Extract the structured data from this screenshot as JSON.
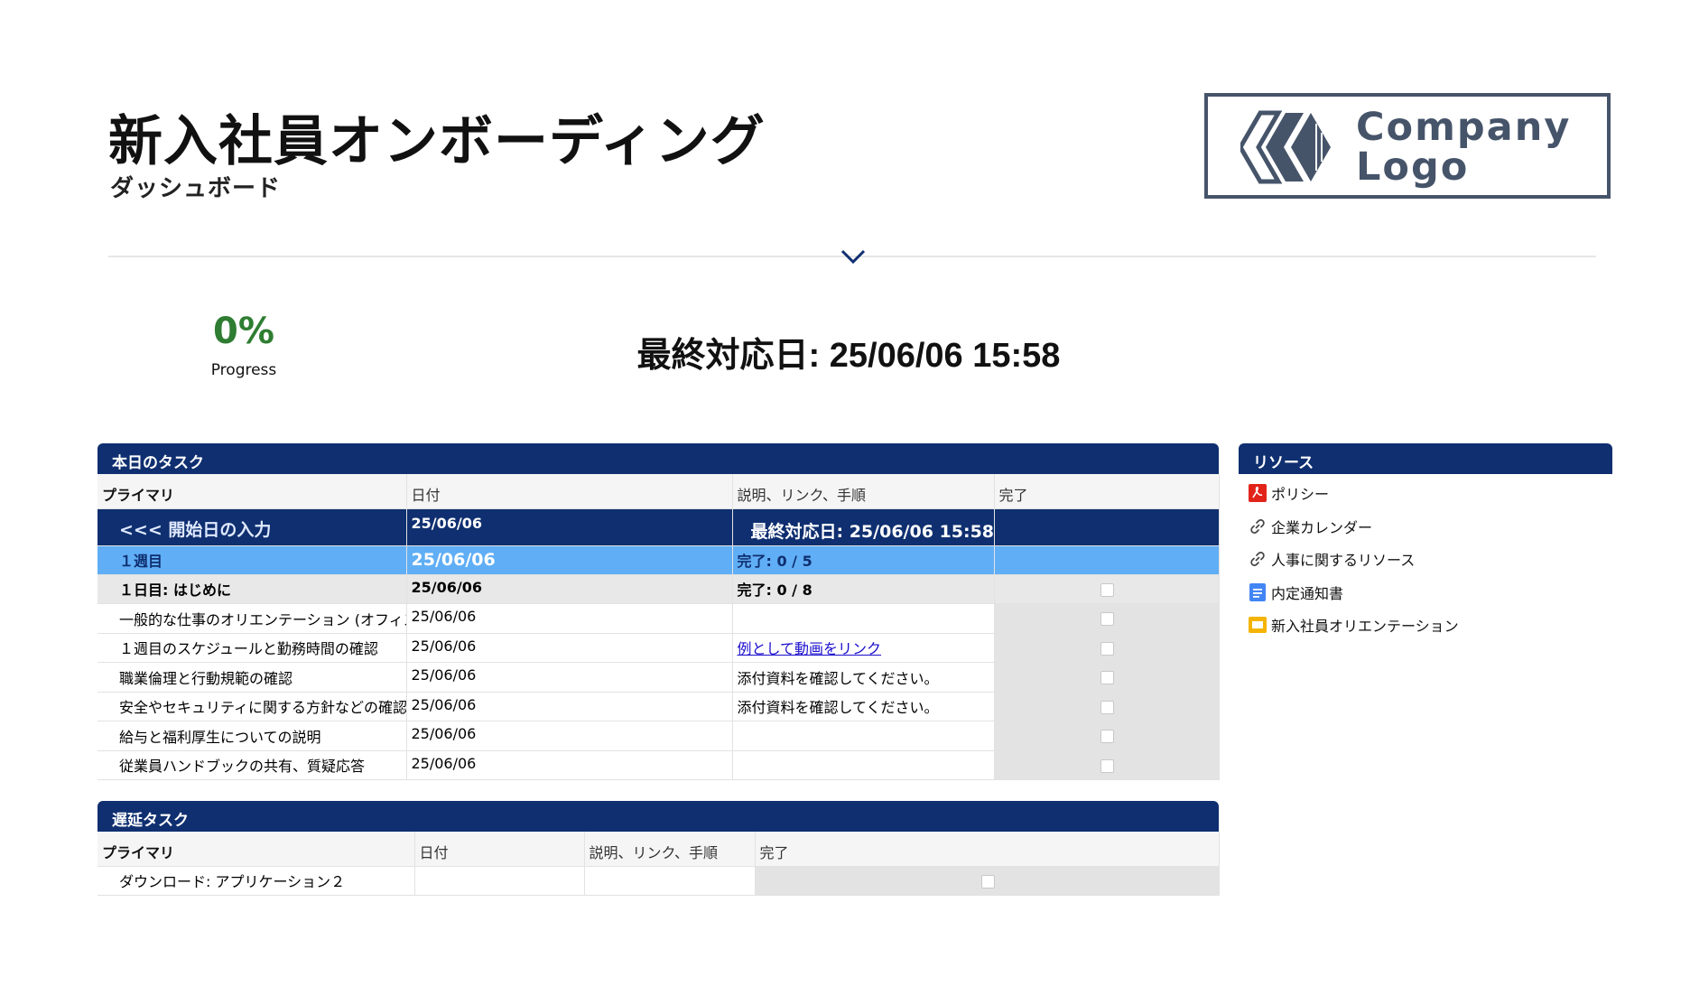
{
  "header": {
    "title": "新入社員オンボーディング",
    "subtitle": "ダッシュボード",
    "logo_text_line1": "Company",
    "logo_text_line2": "Logo"
  },
  "summary": {
    "progress_value": "0%",
    "progress_label": "Progress",
    "last_update": "最終対応日: 25/06/06 15:58"
  },
  "today_tasks": {
    "section_title": "本日のタスク",
    "columns": [
      "プライマリ",
      "日付",
      "説明、リンク、手順",
      "完了"
    ],
    "start_row": {
      "primary": "<<< 開始日の入力",
      "date": "25/06/06",
      "desc": "最終対応日: 25/06/06 15:58"
    },
    "week_row": {
      "primary": "１週目",
      "date": "25/06/06",
      "desc": "完了: 0 / 5"
    },
    "day_row": {
      "primary": "１日目: はじめに",
      "date": "25/06/06",
      "desc": "完了: 0 / 8"
    },
    "rows": [
      {
        "primary": "一般的な仕事のオリエンテーション (オフィスツアー",
        "date": "25/06/06",
        "desc": "",
        "done": false
      },
      {
        "primary": "１週目のスケジュールと勤務時間の確認",
        "date": "25/06/06",
        "desc": "例として動画をリンク",
        "done": false
      },
      {
        "primary": "職業倫理と行動規範の確認",
        "date": "25/06/06",
        "desc": "添付資料を確認してください。",
        "done": false
      },
      {
        "primary": "安全やセキュリティに関する方針などの確認",
        "date": "25/06/06",
        "desc": "添付資料を確認してください。",
        "done": false
      },
      {
        "primary": "給与と福利厚生についての説明",
        "date": "25/06/06",
        "desc": "",
        "done": false
      },
      {
        "primary": "従業員ハンドブックの共有、質疑応答",
        "date": "25/06/06",
        "desc": "",
        "done": false
      }
    ]
  },
  "delayed_tasks": {
    "section_title": "遅延タスク",
    "columns": [
      "プライマリ",
      "日付",
      "説明、リンク、手順",
      "完了"
    ],
    "rows": [
      {
        "primary": "ダウンロード: アプリケーション２",
        "date": "",
        "desc": "",
        "done": false
      }
    ]
  },
  "resources": {
    "section_title": "リソース",
    "items": [
      {
        "label": "ポリシー",
        "icon": "pdf-icon"
      },
      {
        "label": "企業カレンダー",
        "icon": "link-icon"
      },
      {
        "label": "人事に関するリソース",
        "icon": "link-icon"
      },
      {
        "label": "内定通知書",
        "icon": "docs-icon"
      },
      {
        "label": "新入社員オリエンテーション",
        "icon": "slides-icon"
      }
    ]
  },
  "colors": {
    "header_navy": "#0f2f70",
    "week_blue": "#60aef5",
    "progress_green": "#2e7d32",
    "logo_slate": "#46546a"
  }
}
